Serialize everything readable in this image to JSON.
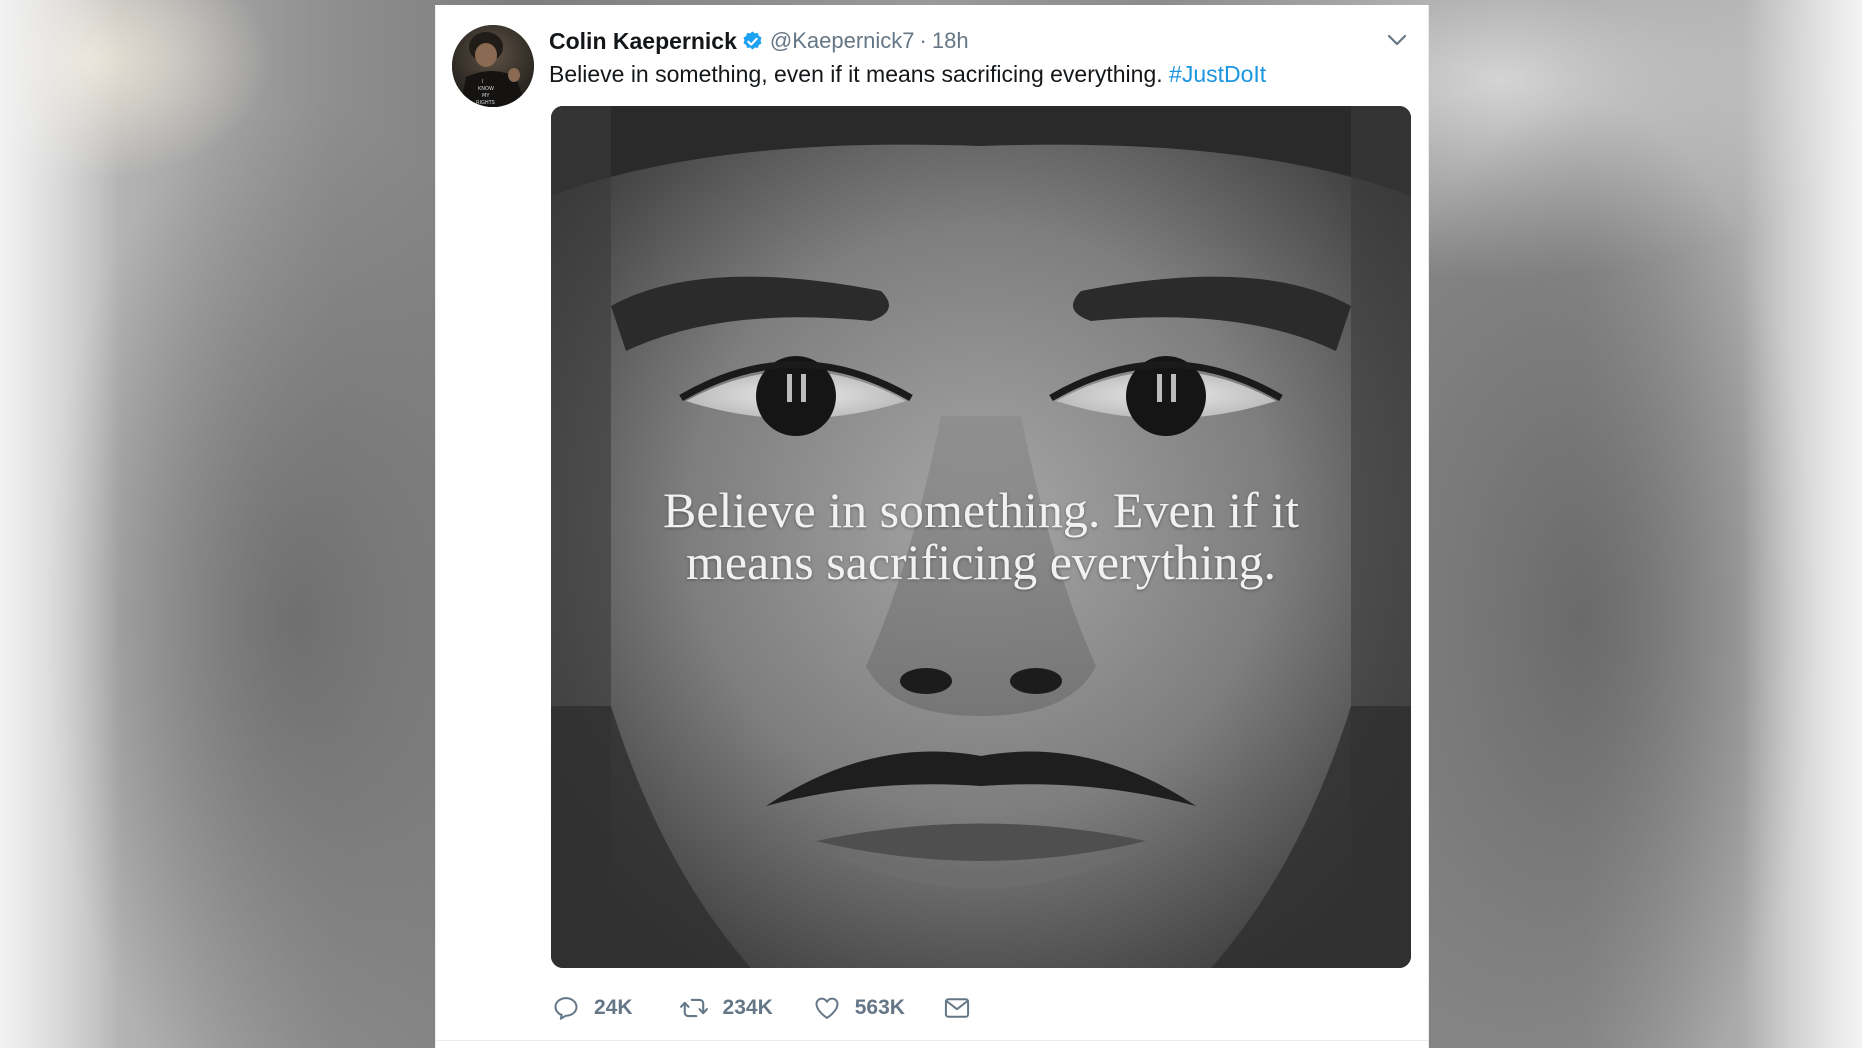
{
  "tweet": {
    "author": {
      "display_name": "Colin Kaepernick",
      "handle": "@Kaepernick7",
      "verified": true,
      "avatar_text": [
        "I",
        "KNOW",
        "MY",
        "RIGHTS"
      ]
    },
    "separator": "·",
    "time": "18h",
    "text": "Believe in something, even if it means sacrificing everything.",
    "hashtag": "#JustDoIt",
    "media": {
      "overlay_line_1": "Believe in something. Even if it",
      "overlay_line_2": "means sacrificing everything."
    },
    "actions": {
      "reply_count": "24K",
      "retweet_count": "234K",
      "like_count": "563K"
    }
  },
  "colors": {
    "name": "#14171a",
    "meta": "#657786",
    "link": "#1b95e0",
    "verified": "#1da1f2"
  },
  "icons": [
    "verified-badge-icon",
    "chevron-down-icon",
    "reply-icon",
    "retweet-icon",
    "heart-icon",
    "envelope-icon"
  ]
}
